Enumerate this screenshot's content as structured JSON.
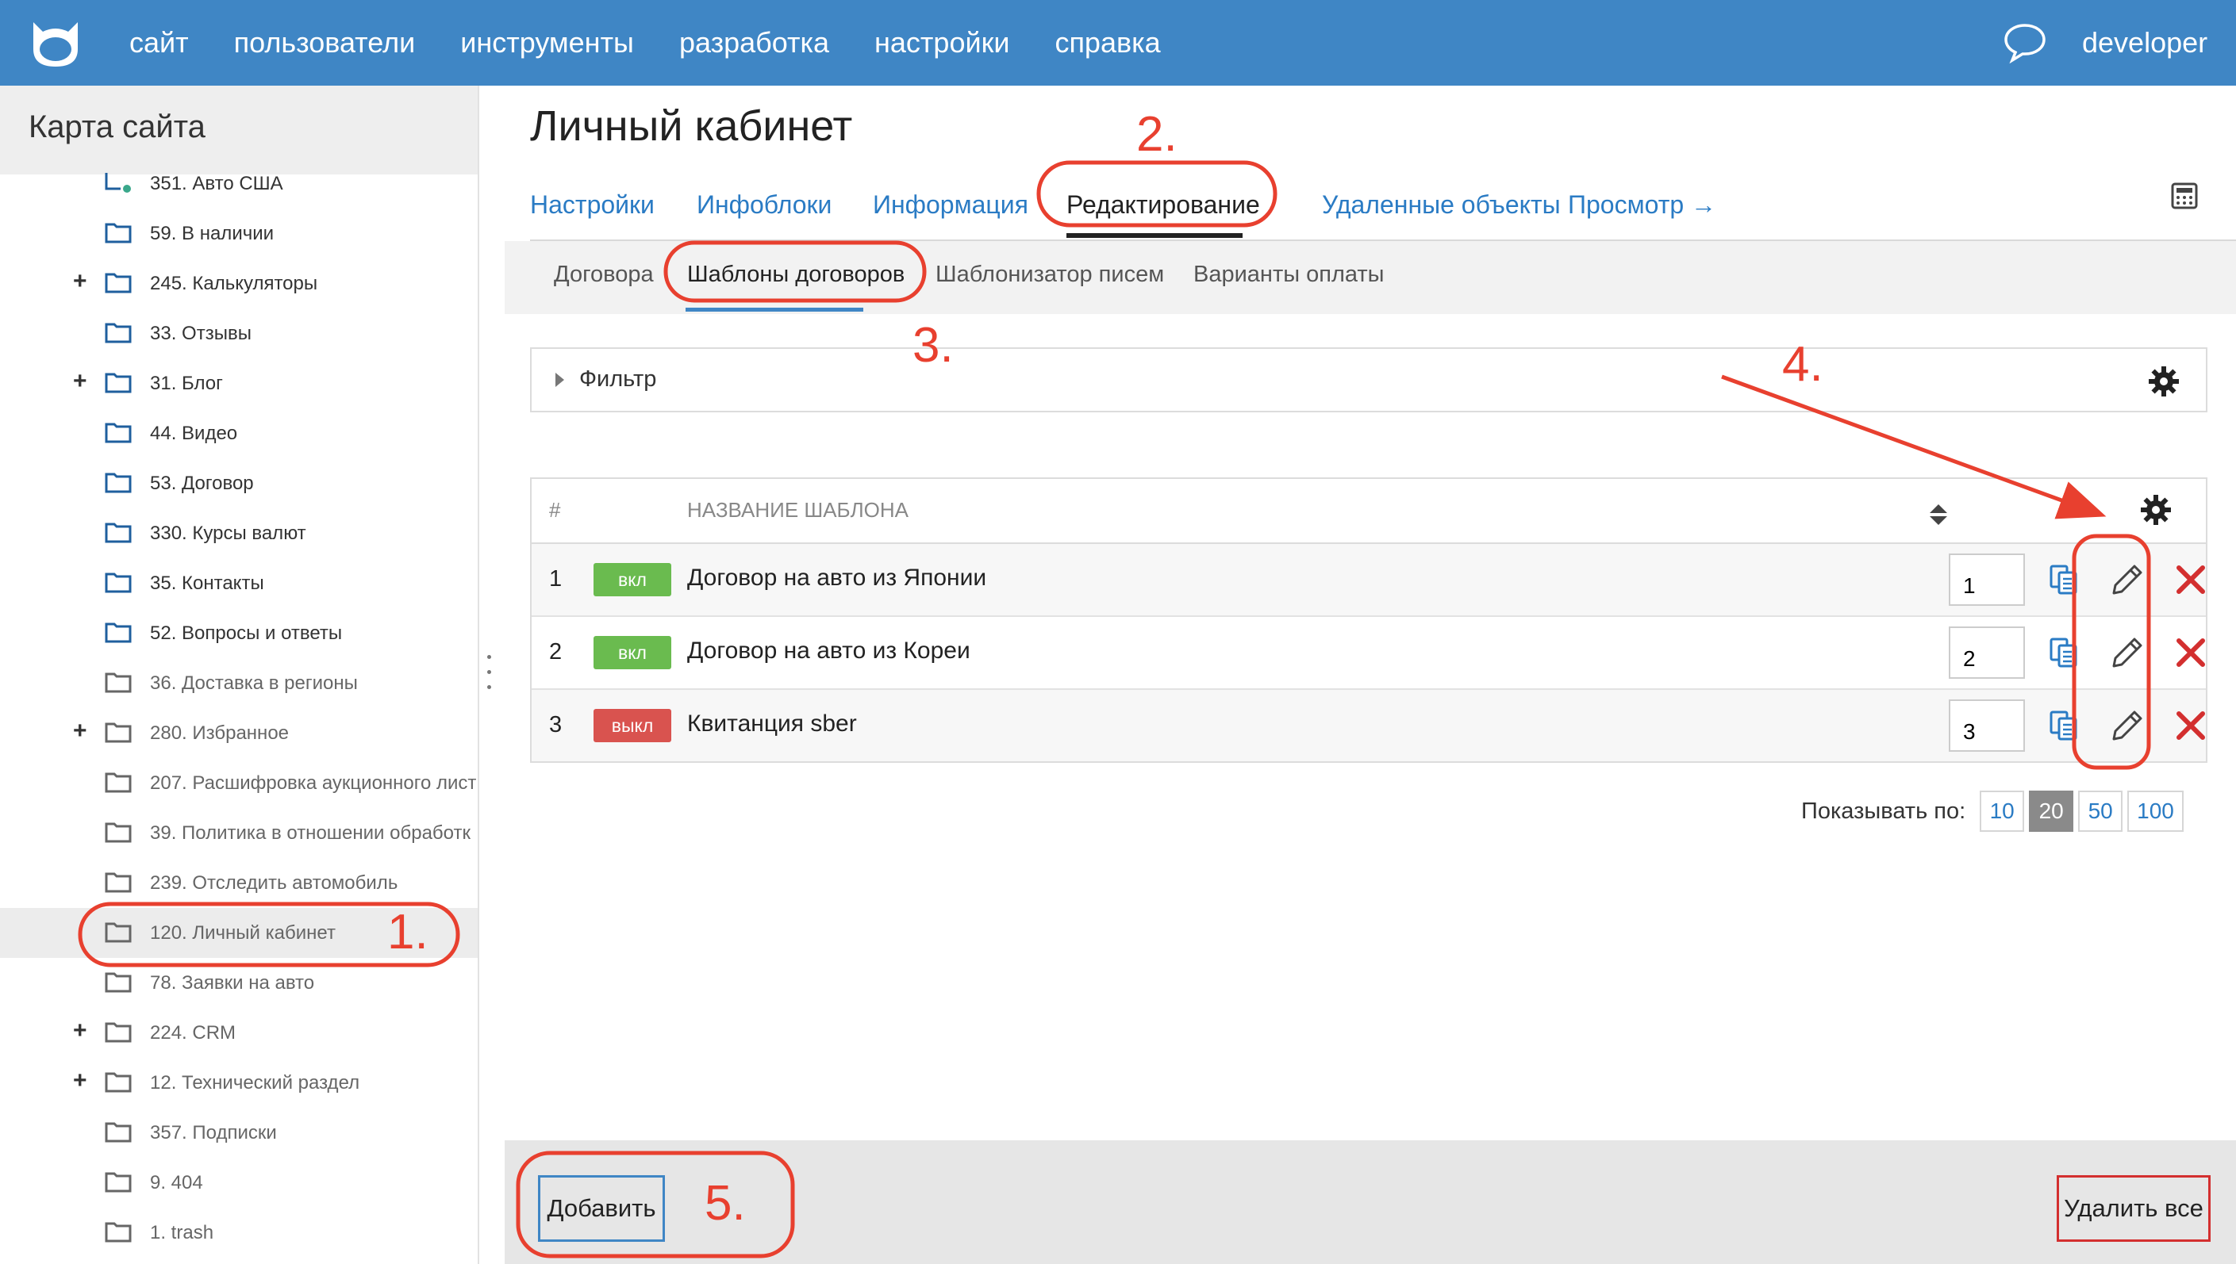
{
  "topbar": {
    "nav": [
      "сайт",
      "пользователи",
      "инструменты",
      "разработка",
      "настройки",
      "справка"
    ],
    "user": "developer",
    "logo_icon": "cat-logo-icon",
    "chat_icon": "chat-bubble-icon",
    "background": "#3f86c5"
  },
  "sidebar": {
    "title": "Карта сайта",
    "items": [
      {
        "label": "351. Авто США",
        "expand": "",
        "icon": "page-dot-icon"
      },
      {
        "label": "59. В наличии",
        "expand": "",
        "icon": "folder-icon"
      },
      {
        "label": "245. Калькуляторы",
        "expand": "+",
        "icon": "folder-icon"
      },
      {
        "label": "33. Отзывы",
        "expand": "",
        "icon": "folder-icon"
      },
      {
        "label": "31. Блог",
        "expand": "+",
        "icon": "folder-icon"
      },
      {
        "label": "44. Видео",
        "expand": "",
        "icon": "folder-icon"
      },
      {
        "label": "53. Договор",
        "expand": "",
        "icon": "folder-icon"
      },
      {
        "label": "330. Курсы валют",
        "expand": "",
        "icon": "folder-icon"
      },
      {
        "label": "35. Контакты",
        "expand": "",
        "icon": "folder-icon"
      },
      {
        "label": "52. Вопросы и ответы",
        "expand": "",
        "icon": "folder-icon"
      },
      {
        "label": "36. Доставка в регионы",
        "expand": "",
        "icon": "folder-gray-icon"
      },
      {
        "label": "280. Избранное",
        "expand": "+",
        "icon": "folder-gray-icon"
      },
      {
        "label": "207. Расшифровка аукционного лист",
        "expand": "",
        "icon": "folder-gray-icon"
      },
      {
        "label": "39. Политика в отношении обработк",
        "expand": "",
        "icon": "folder-gray-icon"
      },
      {
        "label": "239. Отследить автомобиль",
        "expand": "",
        "icon": "folder-gray-icon"
      },
      {
        "label": "120. Личный кабинет",
        "expand": "",
        "icon": "folder-gray-icon",
        "selected": true
      },
      {
        "label": "78. Заявки на авто",
        "expand": "",
        "icon": "folder-gray-icon"
      },
      {
        "label": "224. CRM",
        "expand": "+",
        "icon": "folder-gray-icon"
      },
      {
        "label": "12. Технический раздел",
        "expand": "+",
        "icon": "folder-gray-icon"
      },
      {
        "label": "357. Подписки",
        "expand": "",
        "icon": "folder-gray-icon"
      },
      {
        "label": "9. 404",
        "expand": "",
        "icon": "folder-gray-icon"
      },
      {
        "label": "1. trash",
        "expand": "",
        "icon": "folder-gray-icon"
      }
    ]
  },
  "main": {
    "title": "Личный кабинет",
    "tabs": [
      "Настройки",
      "Инфоблоки",
      "Информация",
      "Редактирование",
      "Удаленные объекты",
      "Просмотр →"
    ],
    "active_tab": "Редактирование",
    "subtabs": [
      "Договора",
      "Шаблоны договоров",
      "Шаблонизатор писем",
      "Варианты оплаты"
    ],
    "active_subtab": "Шаблоны договоров",
    "filter_label": "Фильтр",
    "table": {
      "headers": [
        "#",
        "НАЗВАНИЕ ШАБЛОНА"
      ],
      "rows": [
        {
          "num": "1",
          "status": "вкл",
          "name": "Договор на авто из Японии",
          "priority": "1"
        },
        {
          "num": "2",
          "status": "вкл",
          "name": "Договор на авто из Кореи",
          "priority": "2"
        },
        {
          "num": "3",
          "status": "выкл",
          "name": "Квитанция sber",
          "priority": "3"
        }
      ]
    },
    "pager": {
      "label": "Показывать по:",
      "options": [
        "10",
        "20",
        "50",
        "100"
      ],
      "selected": "20"
    },
    "footer": {
      "add_label": "Добавить",
      "delete_all_label": "Удалить все"
    }
  },
  "annotations": {
    "color": "#e8402f",
    "numbers": [
      "1.",
      "2.",
      "3.",
      "4.",
      "5."
    ]
  }
}
